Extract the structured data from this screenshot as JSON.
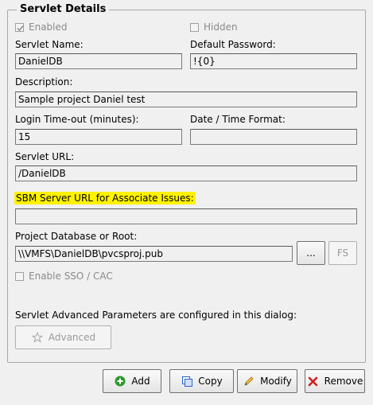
{
  "groupbox": {
    "title": "Servlet Details"
  },
  "enabled": {
    "label": "Enabled",
    "checked": true
  },
  "hidden": {
    "label": "Hidden",
    "checked": false
  },
  "servlet_name": {
    "label": "Servlet Name:",
    "value": "DanielDB"
  },
  "default_password": {
    "label": "Default Password:",
    "value": "!{0}"
  },
  "description": {
    "label": "Description:",
    "value": "Sample project Daniel test"
  },
  "login_timeout": {
    "label": "Login Time-out (minutes):",
    "value": "15"
  },
  "date_time_format": {
    "label": "Date / Time Format:",
    "value": ""
  },
  "servlet_url": {
    "label": "Servlet URL:",
    "value": "/DanielDB"
  },
  "sbm_server_url": {
    "label": "SBM Server URL for Associate Issues:",
    "value": "",
    "highlight_color": "#fff200"
  },
  "project_db": {
    "label": "Project Database or Root:",
    "value": "\\\\VMFS\\DanielDB\\pvcsproj.pub",
    "browse_label": "...",
    "fs_label": "FS"
  },
  "sso": {
    "label": "Enable SSO / CAC",
    "checked": false
  },
  "advanced": {
    "note": "Servlet Advanced Parameters are configured in this dialog:",
    "button_label": "Advanced",
    "icon": "star-icon"
  },
  "actions": {
    "add": {
      "label": "Add",
      "icon": "plus-circle-icon",
      "color": "#2e9a2e"
    },
    "copy": {
      "label": "Copy",
      "icon": "copy-icon",
      "color": "#2a64c8"
    },
    "modify": {
      "label": "Modify",
      "icon": "pencil-icon",
      "color": "#e0a020"
    },
    "remove": {
      "label": "Remove",
      "icon": "x-icon",
      "color": "#d02020"
    }
  }
}
